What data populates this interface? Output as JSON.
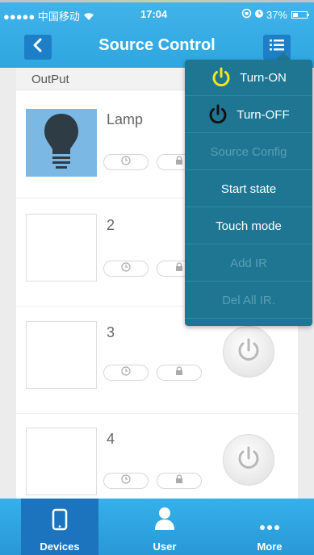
{
  "status_bar": {
    "carrier": "●●●●● 中国移动",
    "time": "17:04",
    "battery": "37%",
    "battery_level": 0.37
  },
  "header": {
    "title": "Source Control",
    "back_icon": "chevron-left-icon",
    "menu_icon": "list-menu-icon"
  },
  "content": {
    "section_label": "OutPut",
    "devices": [
      {
        "name": "Lamp",
        "thumbnail_icon": "lightbulb-icon"
      },
      {
        "name": "2"
      },
      {
        "name": "3"
      },
      {
        "name": "4"
      }
    ]
  },
  "dropdown_menu": {
    "items": [
      {
        "label": "Turn-ON",
        "icon": "power-icon",
        "icon_color": "#f3e81c",
        "enabled": true
      },
      {
        "label": "Turn-OFF",
        "icon": "power-icon",
        "icon_color": "#111111",
        "enabled": true
      },
      {
        "label": "Source Config",
        "enabled": false
      },
      {
        "label": "Start state",
        "enabled": true
      },
      {
        "label": "Touch mode",
        "enabled": true
      },
      {
        "label": "Add IR",
        "enabled": false
      },
      {
        "label": "Del All IR.",
        "enabled": false
      }
    ]
  },
  "tabbar": {
    "tabs": [
      {
        "label": "Devices",
        "icon": "phone-icon",
        "active": true
      },
      {
        "label": "User",
        "icon": "user-icon",
        "active": false
      },
      {
        "label": "More",
        "icon": "more-dots-icon",
        "active": false
      }
    ]
  },
  "colors": {
    "header_blue": "#3aaee6",
    "button_blue": "#1d7fc8",
    "menu_teal": "#1e7692",
    "active_tab": "#1b74bd",
    "turn_on_yellow": "#f3e81c"
  }
}
